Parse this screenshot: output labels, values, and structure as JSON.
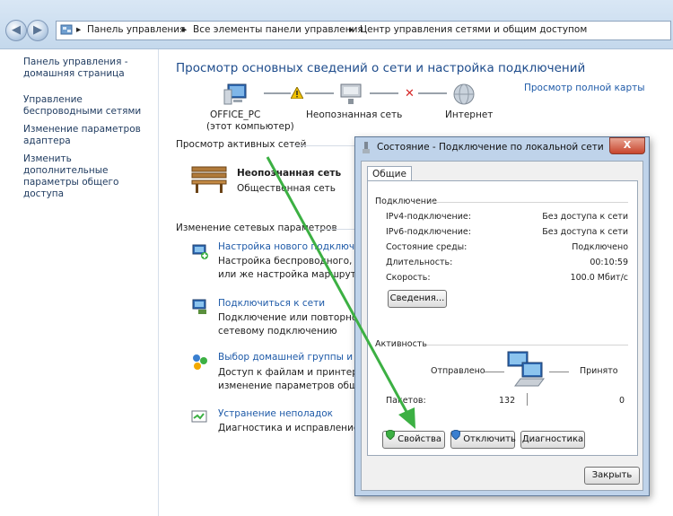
{
  "breadcrumb": {
    "item1": "Панель управления",
    "item2": "Все элементы панели управления",
    "item3": "Центр управления сетями и общим доступом",
    "separator": "▸"
  },
  "sidebar": {
    "items": [
      {
        "label": "Панель управления - домашняя страница"
      },
      {
        "label": "Управление беспроводными сетями"
      },
      {
        "label": "Изменение параметров адаптера"
      },
      {
        "label": "Изменить дополнительные параметры общего доступа"
      }
    ]
  },
  "main": {
    "title": "Просмотр основных сведений о сети и настройка подключений",
    "full_map_link": "Просмотр полной карты",
    "map": {
      "computer_name": "OFFICE_PC",
      "computer_sub": "(этот компьютер)",
      "network_name": "Неопознанная сеть",
      "internet_label": "Интернет"
    },
    "active_networks_heading": "Просмотр активных сетей",
    "active_network": {
      "name": "Неопознанная сеть",
      "type": "Общественная сеть"
    },
    "change_settings_heading": "Изменение сетевых параметров",
    "tasks": [
      {
        "title": "Настройка нового подключения",
        "desc1": "Настройка беспроводного, широ",
        "desc2": "или же настройка маршрутизато"
      },
      {
        "title": "Подключиться к сети",
        "desc1": "Подключение или повторное п",
        "desc2": "сетевому подключению"
      },
      {
        "title": "Выбор домашней группы и пар",
        "desc1": "Доступ к файлам и принтерам,",
        "desc2": "изменение параметров общего"
      },
      {
        "title": "Устранение неполадок",
        "desc1": "Диагностика и исправление се",
        "desc2": ""
      }
    ]
  },
  "dialog": {
    "title": "Состояние - Подключение по локальной сети",
    "close_glyph": "X",
    "tab": "Общие",
    "connection_group": "Подключение",
    "rows": [
      {
        "label": "IPv4-подключение:",
        "value": "Без доступа к сети"
      },
      {
        "label": "IPv6-подключение:",
        "value": "Без доступа к сети"
      },
      {
        "label": "Состояние среды:",
        "value": "Подключено"
      },
      {
        "label": "Длительность:",
        "value": "00:10:59"
      },
      {
        "label": "Скорость:",
        "value": "100.0 Мбит/с"
      }
    ],
    "details_button": "Сведения...",
    "activity_group": "Активность",
    "sent_label": "Отправлено",
    "received_label": "Принято",
    "packets_label": "Пакетов:",
    "packets_sent": "132",
    "packets_received": "0",
    "buttons": {
      "properties": "Свойства",
      "disable": "Отключить",
      "diagnose": "Диагностика",
      "close": "Закрыть"
    }
  },
  "colors": {
    "link": "#1e5aa8",
    "heading": "#1d4b8b",
    "annotation_arrow": "#3cb043",
    "error_x": "#d62828",
    "warning": "#f2c200"
  }
}
